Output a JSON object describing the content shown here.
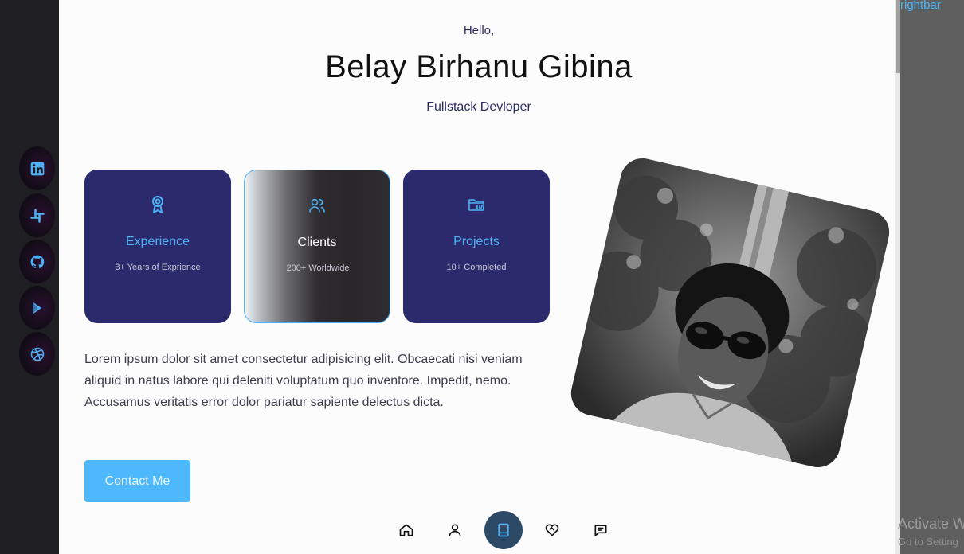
{
  "socials": [
    {
      "name": "linkedin"
    },
    {
      "name": "slack"
    },
    {
      "name": "github"
    },
    {
      "name": "google-play"
    },
    {
      "name": "dribbble"
    }
  ],
  "hero": {
    "greeting": "Hello,",
    "name": "Belay Birhanu Gibina",
    "role": "Fullstack Devloper"
  },
  "cards": [
    {
      "icon": "award-icon",
      "title": "Experience",
      "sub": "3+ Years of Exprience",
      "active": false
    },
    {
      "icon": "users-icon",
      "title": "Clients",
      "sub": "200+ Worldwide",
      "active": true
    },
    {
      "icon": "folder-icon",
      "title": "Projects",
      "sub": "10+ Completed",
      "active": false
    }
  ],
  "about": {
    "text": "Lorem ipsum dolor sit amet consectetur adipisicing elit. Obcaecati nisi veniam aliquid in natus labore qui deleniti voluptatum quo inventore. Impedit, nemo. Accusamus veritatis error dolor pariatur sapiente delectus dicta."
  },
  "contact": {
    "label": "Contact Me"
  },
  "nav": [
    {
      "icon": "home-icon"
    },
    {
      "icon": "user-icon"
    },
    {
      "icon": "book-icon",
      "active": true
    },
    {
      "icon": "heart-handshake-icon"
    },
    {
      "icon": "message-icon"
    }
  ],
  "rightbar": {
    "label": "rightbar"
  },
  "watermark": {
    "title": "Activate W",
    "sub": "Go to Setting"
  },
  "colors": {
    "accent": "#4db1f5",
    "card": "#2a2a6c",
    "sidebar": "#1f1e23",
    "nav_active": "#2c4a66"
  }
}
